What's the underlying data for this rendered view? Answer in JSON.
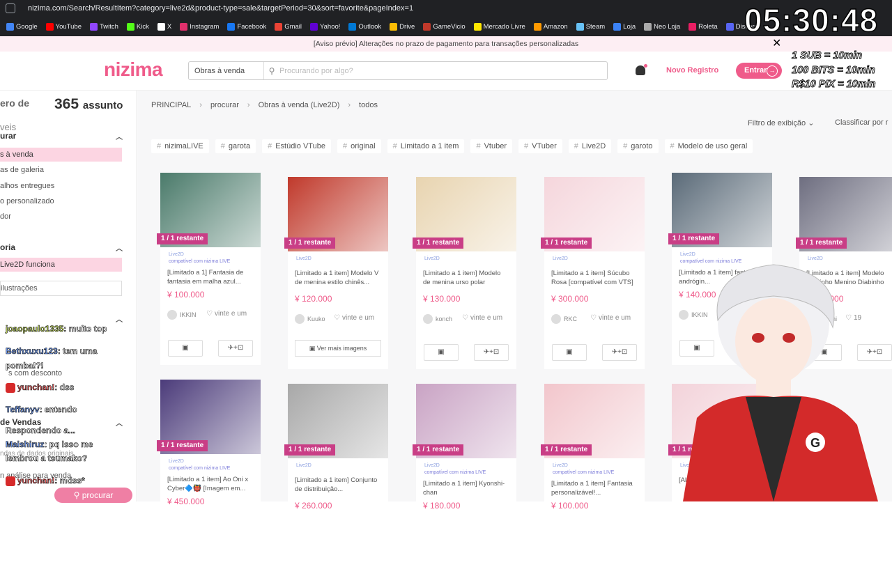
{
  "browser": {
    "url": "nizima.com/Search/ResultItem?category=live2d&product-type=sale&targetPeriod=30&sort=favorite&pageIndex=1",
    "bookmarks": [
      {
        "label": "Google",
        "color": "#4285f4"
      },
      {
        "label": "YouTube",
        "color": "#ff0000"
      },
      {
        "label": "Twitch",
        "color": "#9146ff"
      },
      {
        "label": "Kick",
        "color": "#53fc18"
      },
      {
        "label": "X",
        "color": "#ffffff"
      },
      {
        "label": "Instagram",
        "color": "#e1306c"
      },
      {
        "label": "Facebook",
        "color": "#1877f2"
      },
      {
        "label": "Gmail",
        "color": "#ea4335"
      },
      {
        "label": "Yahoo!",
        "color": "#6001d2"
      },
      {
        "label": "Outlook",
        "color": "#0078d4"
      },
      {
        "label": "Drive",
        "color": "#fbbc04"
      },
      {
        "label": "GameVicio",
        "color": "#c0392b"
      },
      {
        "label": "Mercado Livre",
        "color": "#ffe600"
      },
      {
        "label": "Amazon",
        "color": "#ff9900"
      },
      {
        "label": "Steam",
        "color": "#66c0f4"
      },
      {
        "label": "Loja",
        "color": "#3b82f6"
      },
      {
        "label": "Neo Loja",
        "color": "#aaaaaa"
      },
      {
        "label": "Roleta",
        "color": "#e91e63"
      },
      {
        "label": "Discord",
        "color": "#5865f2"
      }
    ]
  },
  "notice": {
    "text": "[Aviso prévio] Alterações no prazo de pagamento para transações personalizadas",
    "close": "✕"
  },
  "header": {
    "logo": "nizima",
    "search_category": "Obras à venda",
    "search_placeholder": "Procurando por algo?",
    "register": "Novo Registro",
    "login": "Entrar"
  },
  "stream": {
    "timer": "05:30:48",
    "goals": [
      "1 SUB = 10min",
      "100 BITS = 10min",
      "R$10 PIX = 10min"
    ],
    "chat": [
      {
        "user": "joaopaulo1335",
        "msg": ": muito top",
        "style": "g"
      },
      {
        "user": "Bethxuxu123",
        "msg": ": tem uma",
        "style": "b"
      },
      {
        "user": "",
        "msg": "pomba!?!",
        "style": "b"
      },
      {
        "user": "yunchan!",
        "msg": ": dss",
        "style": "r"
      },
      {
        "user": "Teffanyv",
        "msg": ": entendo",
        "style": "b"
      },
      {
        "user": "",
        "msg": "Respondendo a...",
        "style": "g"
      },
      {
        "user": "Maishiruz",
        "msg": ": pq isso me",
        "style": "b"
      },
      {
        "user": "",
        "msg": "lembrou a tsumako?",
        "style": "b"
      },
      {
        "user": "yunchan!",
        "msg": ": mdss*",
        "style": "r"
      }
    ]
  },
  "sidebar": {
    "count_label": "ero de",
    "count_num": "365",
    "count_unit": "assunto",
    "count_sub": "veis",
    "section1": "urar",
    "items1": [
      "s à venda",
      "as de galeria",
      "alhos entregues",
      "o personalizado",
      "dor"
    ],
    "section2": "oria",
    "items2": [
      "Live2D funciona",
      "ilustrações"
    ],
    "section3": "",
    "discount": "s com desconto",
    "section4": "de Vendas",
    "items4": [
      "ndas de dados originais",
      "n análise para venda"
    ],
    "search_btn": "procurar"
  },
  "breadcrumb": [
    "PRINCIPAL",
    "procurar",
    "Obras à venda (Live2D)",
    "todos"
  ],
  "controls": {
    "filter": "Filtro de exibição",
    "sort": "Classificar por r"
  },
  "tags": [
    "nizimaLIVE",
    "garota",
    "Estúdio VTube",
    "original",
    "Limitado a 1 item",
    "Vtuber",
    "VTuber",
    "Live2D",
    "garoto",
    "Modelo de uso geral"
  ],
  "products": [
    {
      "title": "[Limitado a 1] Fantasia de fantasia em malha azul...",
      "price": "¥ 100.000",
      "seller": "IKKIN",
      "fav": "vinte e um",
      "compat": true,
      "color": "#4a7a6a"
    },
    {
      "title": "[Limitado a 1 item] Modelo V de menina estilo chinês...",
      "price": "¥ 120.000",
      "seller": "Kuuko",
      "fav": "vinte e um",
      "compat": false,
      "color": "#c0392b",
      "more": "Ver mais imagens"
    },
    {
      "title": "[Limitado a 1 item] Modelo de menina urso polar",
      "price": "¥ 130.000",
      "seller": "konch",
      "fav": "vinte e um",
      "compat": false,
      "color": "#e8d4b0"
    },
    {
      "title": "[Limitado a 1 item] Súcubo Rosa [compatível com VTS]",
      "price": "¥ 300.000",
      "seller": "RKC",
      "fav": "vinte e um",
      "compat": false,
      "color": "#f5d6dc"
    },
    {
      "title": "[Limitado a 1 item] fantasia andrógin...",
      "price": "¥ 140.000",
      "seller": "IKKIN",
      "fav": "",
      "compat": true,
      "color": "#5a6a78"
    },
    {
      "title": "[Limitado a 1 item] Modelo Diabinho Menino Diabinho",
      "price": "¥ 130.000",
      "seller": "konchi",
      "fav": "19",
      "compat": false,
      "color": "#6e6e80"
    },
    {
      "title": "[Limitado a 1 item] Ao Oni x Cyber🔷👹 [Imagem em...",
      "price": "¥ 450.000",
      "seller": "",
      "fav": "",
      "compat": true,
      "color": "#4b3b7a"
    },
    {
      "title": "[Limitado a 1 item] Conjunto de distribuição...",
      "price": "¥ 260.000",
      "seller": "",
      "fav": "",
      "compat": false,
      "color": "#a8a8a8"
    },
    {
      "title": "[Limitado a 1 item] Kyonshi-chan",
      "price": "¥ 180.000",
      "seller": "",
      "fav": "",
      "compat": true,
      "color": "#c9a3c4"
    },
    {
      "title": "[Limitado a 1 item] Fantasia personalizável!...",
      "price": "¥ 100.000",
      "seller": "",
      "fav": "",
      "compat": true,
      "color": "#f2c6cc"
    },
    {
      "title": "[Alta...",
      "price": "",
      "seller": "",
      "fav": "",
      "compat": false,
      "color": "#f3d3da"
    }
  ],
  "card_text": {
    "badge": "1 / 1  restante",
    "l2d": "Live2D",
    "compat": "compatível com nizima LIVE",
    "cart": "▣",
    "vtuber": "✈+⊡"
  }
}
